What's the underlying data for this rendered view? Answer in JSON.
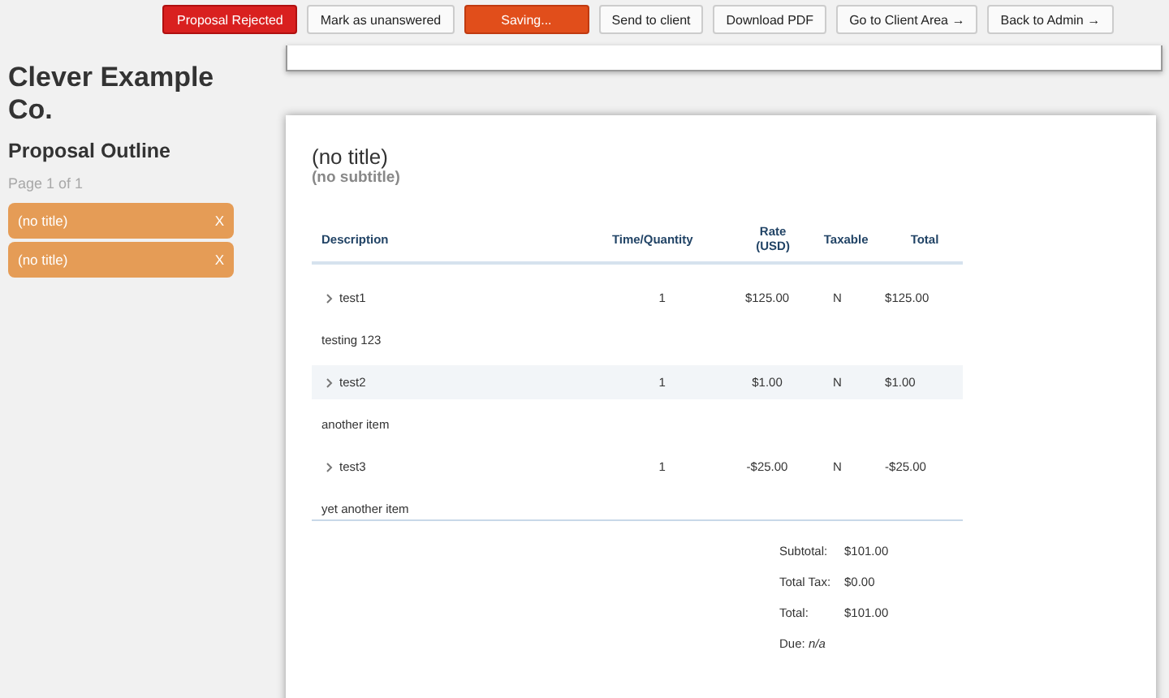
{
  "toolbar": [
    {
      "label": "Proposal Rejected",
      "kind": "danger"
    },
    {
      "label": "Mark as unanswered",
      "kind": "plain"
    },
    {
      "label": "Saving...",
      "kind": "warning"
    },
    {
      "label": "Send to client",
      "kind": "plain"
    },
    {
      "label": "Download PDF",
      "kind": "plain"
    },
    {
      "label": "Go to Client Area →",
      "kind": "plain"
    },
    {
      "label": "Back to Admin →",
      "kind": "plain"
    }
  ],
  "sidebar": {
    "company": "Clever Example Co.",
    "heading": "Proposal Outline",
    "page_info": "Page 1 of 1",
    "sections": [
      {
        "title": "(no title)",
        "remove": "X"
      },
      {
        "title": "(no title)",
        "remove": "X"
      }
    ]
  },
  "proposal": {
    "title": "(no title)",
    "subtitle": "(no subtitle)",
    "table": {
      "columns": [
        "Description",
        "Time/Quantity",
        "Rate (USD)",
        "Taxable",
        "Total"
      ],
      "rows": [
        {
          "kind": "item",
          "cells": [
            "test1",
            "1",
            "$125.00",
            "N",
            "$125.00"
          ]
        },
        {
          "kind": "note",
          "text": "testing 123"
        },
        {
          "kind": "item",
          "cells": [
            "test2",
            "1",
            "$1.00",
            "N",
            "$1.00"
          ]
        },
        {
          "kind": "note",
          "text": "another item"
        },
        {
          "kind": "item",
          "cells": [
            "test3",
            "1",
            "-$25.00",
            "N",
            "-$25.00"
          ]
        },
        {
          "kind": "note",
          "text": "yet another item"
        }
      ]
    },
    "totals": [
      {
        "label": "Subtotal:",
        "value": "$101.00"
      },
      {
        "label": "Total Tax:",
        "value": "$0.00"
      },
      {
        "label": "Total:",
        "value": "$101.00"
      }
    ],
    "due": "Due: *n/a*"
  }
}
